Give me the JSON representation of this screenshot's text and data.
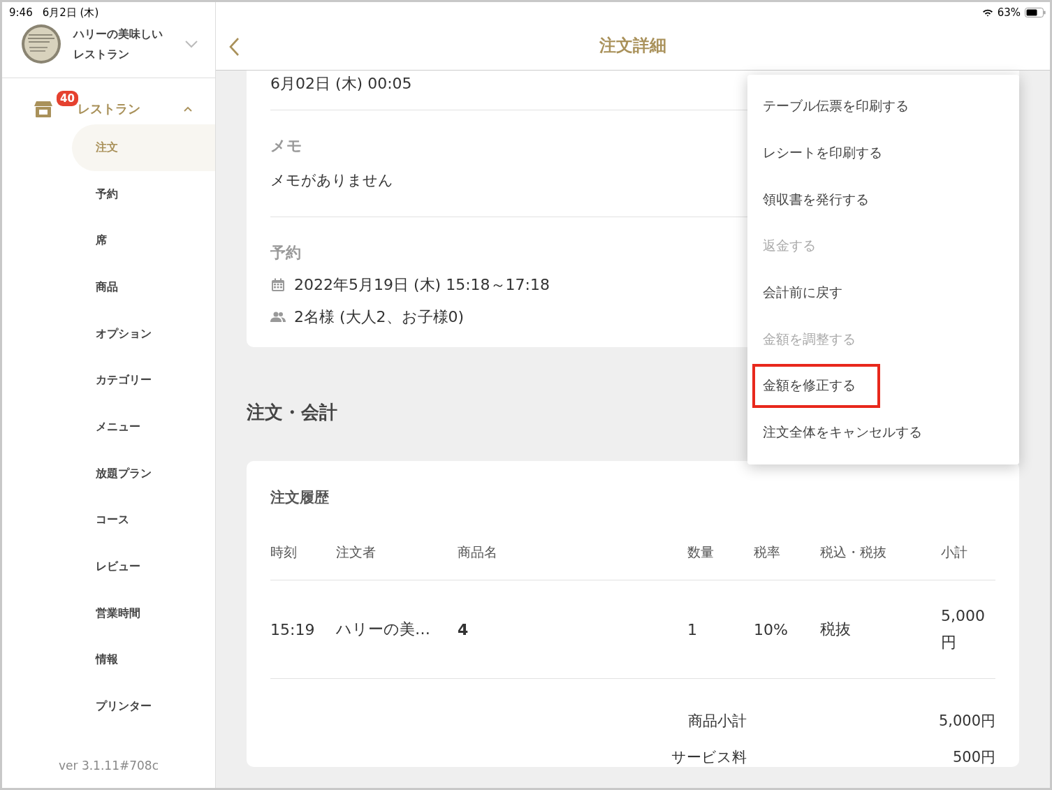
{
  "status_bar": {
    "time": "9:46",
    "date": "6月2日 (木)",
    "battery": "63%"
  },
  "sidebar": {
    "shop_name": "ハリーの美味しいレストラン",
    "group": {
      "label": "レストラン",
      "badge": "40",
      "expanded": true
    },
    "items": [
      {
        "label": "注文",
        "selected": true
      },
      {
        "label": "予約",
        "selected": false
      },
      {
        "label": "席",
        "selected": false
      },
      {
        "label": "商品",
        "selected": false
      },
      {
        "label": "オプション",
        "selected": false
      },
      {
        "label": "カテゴリー",
        "selected": false
      },
      {
        "label": "メニュー",
        "selected": false
      },
      {
        "label": "放題プラン",
        "selected": false
      },
      {
        "label": "コース",
        "selected": false
      },
      {
        "label": "レビュー",
        "selected": false
      },
      {
        "label": "営業時間",
        "selected": false
      },
      {
        "label": "情報",
        "selected": false
      },
      {
        "label": "プリンター",
        "selected": false
      }
    ],
    "version": "ver 3.1.11#708c"
  },
  "header": {
    "title": "注文詳細"
  },
  "order_info": {
    "datetime": "6月02日 (木) 00:05",
    "memo_label": "メモ",
    "memo": "メモがありません",
    "reservation_label": "予約",
    "reservation_date": "2022年5月19日 (木) 15:18～17:18",
    "reservation_guests": "2名様 (大人2、お子様0)"
  },
  "section_title": "注文・会計",
  "history": {
    "title": "注文履歴",
    "columns": [
      "時刻",
      "注文者",
      "商品名",
      "数量",
      "税率",
      "税込・税抜",
      "小計"
    ],
    "rows": [
      [
        "15:19",
        "ハリーの美…",
        "4",
        "1",
        "10%",
        "税抜",
        "5,000円"
      ]
    ],
    "totals": [
      {
        "label": "商品小計",
        "value": "5,000円"
      },
      {
        "label": "サービス料",
        "value": "500円"
      }
    ]
  },
  "menu": {
    "items": [
      {
        "label": "テーブル伝票を印刷する",
        "disabled": false,
        "highlighted": false
      },
      {
        "label": "レシートを印刷する",
        "disabled": false,
        "highlighted": false
      },
      {
        "label": "領収書を発行する",
        "disabled": false,
        "highlighted": false
      },
      {
        "label": "返金する",
        "disabled": true,
        "highlighted": false
      },
      {
        "label": "会計前に戻す",
        "disabled": false,
        "highlighted": false
      },
      {
        "label": "金額を調整する",
        "disabled": true,
        "highlighted": false
      },
      {
        "label": "金額を修正する",
        "disabled": false,
        "highlighted": true
      },
      {
        "label": "注文全体をキャンセルする",
        "disabled": false,
        "highlighted": false
      }
    ]
  }
}
